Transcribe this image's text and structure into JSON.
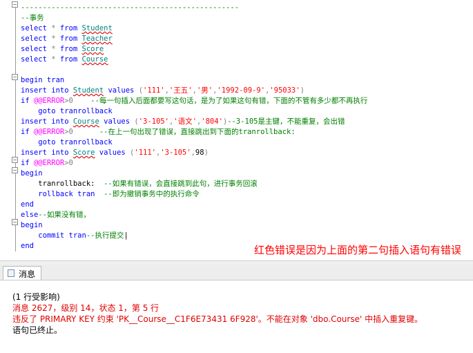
{
  "editor": {
    "lines": [
      {
        "segs": [
          {
            "t": "--------------------------------------------------",
            "c": "cmt"
          }
        ]
      },
      {
        "segs": [
          {
            "t": "--事务",
            "c": "cmt"
          }
        ]
      },
      {
        "segs": [
          {
            "t": "select",
            "c": "kw"
          },
          {
            "t": " * ",
            "c": "gray"
          },
          {
            "t": "from",
            "c": "kw"
          },
          {
            "t": " ",
            "c": "blk"
          },
          {
            "t": "Student",
            "c": "obj"
          }
        ]
      },
      {
        "segs": [
          {
            "t": "select",
            "c": "kw"
          },
          {
            "t": " * ",
            "c": "gray"
          },
          {
            "t": "from",
            "c": "kw"
          },
          {
            "t": " ",
            "c": "blk"
          },
          {
            "t": "Teacher",
            "c": "obj"
          }
        ]
      },
      {
        "segs": [
          {
            "t": "select",
            "c": "kw"
          },
          {
            "t": " * ",
            "c": "gray"
          },
          {
            "t": "from",
            "c": "kw"
          },
          {
            "t": " ",
            "c": "blk"
          },
          {
            "t": "Score",
            "c": "obj"
          }
        ]
      },
      {
        "segs": [
          {
            "t": "select",
            "c": "kw"
          },
          {
            "t": " * ",
            "c": "gray"
          },
          {
            "t": "from",
            "c": "kw"
          },
          {
            "t": " ",
            "c": "blk"
          },
          {
            "t": "Course",
            "c": "obj"
          }
        ]
      },
      {
        "segs": []
      },
      {
        "segs": [
          {
            "t": "begin tran",
            "c": "kw"
          }
        ]
      },
      {
        "segs": [
          {
            "t": "insert into ",
            "c": "kw"
          },
          {
            "t": "Student",
            "c": "obj"
          },
          {
            "t": " values ",
            "c": "kw"
          },
          {
            "t": "(",
            "c": "gray"
          },
          {
            "t": "'111'",
            "c": "str"
          },
          {
            "t": ",",
            "c": "gray"
          },
          {
            "t": "'王五'",
            "c": "str"
          },
          {
            "t": ",",
            "c": "gray"
          },
          {
            "t": "'男'",
            "c": "str"
          },
          {
            "t": ",",
            "c": "gray"
          },
          {
            "t": "'1992-09-9'",
            "c": "str"
          },
          {
            "t": ",",
            "c": "gray"
          },
          {
            "t": "'95033'",
            "c": "str"
          },
          {
            "t": ")",
            "c": "gray"
          }
        ]
      },
      {
        "segs": [
          {
            "t": "if ",
            "c": "kw"
          },
          {
            "t": "@@ERROR",
            "c": "sys"
          },
          {
            "t": ">0",
            "c": "gray"
          },
          {
            "t": "    --每一句插入后面都要写这句话，是为了如果这句有错，下面的不管有多少都不再执行",
            "c": "cmt"
          }
        ]
      },
      {
        "segs": [
          {
            "t": "    goto tranrollback",
            "c": "kw"
          }
        ]
      },
      {
        "segs": [
          {
            "t": "insert into ",
            "c": "kw"
          },
          {
            "t": "Course",
            "c": "obj"
          },
          {
            "t": " values ",
            "c": "kw"
          },
          {
            "t": "(",
            "c": "gray"
          },
          {
            "t": "'3-105'",
            "c": "str"
          },
          {
            "t": ",",
            "c": "gray"
          },
          {
            "t": "'语文'",
            "c": "str"
          },
          {
            "t": ",",
            "c": "gray"
          },
          {
            "t": "'804'",
            "c": "str"
          },
          {
            "t": ")",
            "c": "gray"
          },
          {
            "t": "--3-105是主键，不能重复，会出错",
            "c": "cmt"
          }
        ]
      },
      {
        "segs": [
          {
            "t": "if ",
            "c": "kw"
          },
          {
            "t": "@@ERROR",
            "c": "sys"
          },
          {
            "t": ">0",
            "c": "gray"
          },
          {
            "t": "      --在上一句出现了错误，直接跳出到下面的tranrollback:",
            "c": "cmt"
          }
        ]
      },
      {
        "segs": [
          {
            "t": "    goto tranrollback",
            "c": "kw"
          }
        ]
      },
      {
        "segs": [
          {
            "t": "insert into ",
            "c": "kw"
          },
          {
            "t": "Score",
            "c": "obj"
          },
          {
            "t": " values ",
            "c": "kw"
          },
          {
            "t": "(",
            "c": "gray"
          },
          {
            "t": "'111'",
            "c": "str"
          },
          {
            "t": ",",
            "c": "gray"
          },
          {
            "t": "'3-105'",
            "c": "str"
          },
          {
            "t": ",",
            "c": "gray"
          },
          {
            "t": "98",
            "c": "blk"
          },
          {
            "t": ")",
            "c": "gray"
          }
        ]
      },
      {
        "segs": [
          {
            "t": "if ",
            "c": "kw"
          },
          {
            "t": "@@ERROR",
            "c": "sys"
          },
          {
            "t": ">0",
            "c": "gray"
          }
        ]
      },
      {
        "segs": [
          {
            "t": "begin",
            "c": "kw"
          }
        ]
      },
      {
        "segs": [
          {
            "t": "    tranrollback:",
            "c": "blk"
          },
          {
            "t": "  --如果有错误，会直接跳到此句，进行事务回滚",
            "c": "cmt"
          }
        ]
      },
      {
        "segs": [
          {
            "t": "    rollback tran",
            "c": "kw"
          },
          {
            "t": "  --即为撤销事务中的执行命令",
            "c": "cmt"
          }
        ]
      },
      {
        "segs": [
          {
            "t": "end",
            "c": "kw"
          }
        ]
      },
      {
        "segs": [
          {
            "t": "else",
            "c": "kw"
          },
          {
            "t": "--如果没有错，",
            "c": "cmt"
          }
        ]
      },
      {
        "segs": [
          {
            "t": "begin",
            "c": "kw"
          }
        ]
      },
      {
        "segs": [
          {
            "t": "    commit tran",
            "c": "kw"
          },
          {
            "t": "--执行提交",
            "c": "cmt"
          },
          {
            "t": "|",
            "c": "blk"
          }
        ]
      },
      {
        "segs": [
          {
            "t": "end",
            "c": "kw"
          }
        ]
      }
    ]
  },
  "annotation": "红色错误是因为上面的第二句插入语句有错误",
  "messages_tab": {
    "label": "消息",
    "icon": "message-icon"
  },
  "messages": [
    {
      "text": "(1 行受影响)",
      "color": "black"
    },
    {
      "text": "消息 2627，级别 14，状态 1，第 5 行",
      "color": "red"
    },
    {
      "text": "违反了 PRIMARY KEY 约束 'PK__Course__C1F6E73431 6F928'。不能在对象 'dbo.Course' 中插入重复键。",
      "color": "red"
    },
    {
      "text": "语句已终止。",
      "color": "black"
    }
  ],
  "colors": {
    "keyword": "#0000ff",
    "object": "#008080",
    "string": "#ff0000",
    "comment": "#008000",
    "system": "#ff00ff",
    "error": "#e00000"
  }
}
